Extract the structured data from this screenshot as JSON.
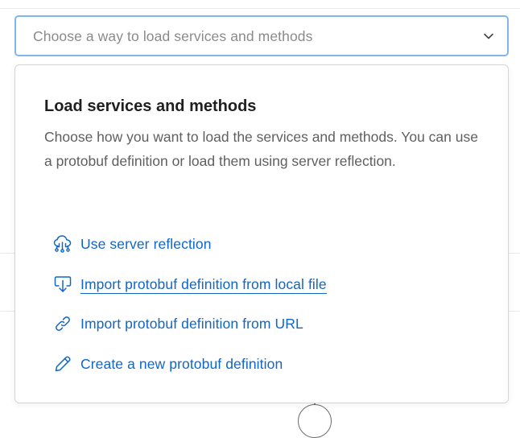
{
  "select": {
    "placeholder": "Choose a way to load services and methods",
    "icon": "chevron-down-icon"
  },
  "popover": {
    "title": "Load services and methods",
    "description": "Choose how you want to load the services and methods. You can use a protobuf definition or load them using server reflection.",
    "options": [
      {
        "label": "Use server reflection",
        "icon": "cloud-network-icon"
      },
      {
        "label": "Import protobuf definition from local file",
        "icon": "import-icon"
      },
      {
        "label": "Import protobuf definition from URL",
        "icon": "link-icon"
      },
      {
        "label": "Create a new protobuf definition",
        "icon": "pencil-icon"
      }
    ]
  },
  "colors": {
    "link": "#1166c7",
    "focus_border": "#84b5ec",
    "placeholder": "#8b8b8b",
    "title": "#1f1f1f",
    "description": "#5f5f5f"
  }
}
